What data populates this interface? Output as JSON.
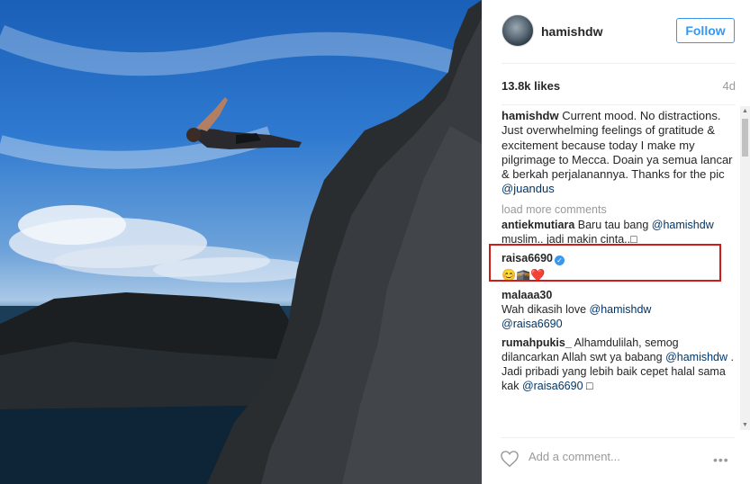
{
  "post": {
    "username": "hamishdw",
    "follow_label": "Follow",
    "likes": "13.8k likes",
    "time_ago": "4d",
    "caption_user": "hamishdw",
    "caption_text": " Current mood. No distractions. Just overwhelming feelings of gratitude & excitement because today I make my pilgrimage to Mecca. Doain ya semua lancar & berkah perjalanannya. Thanks for the pic ",
    "caption_mention": "@juandus",
    "load_more": "load more comments",
    "add_comment_placeholder": "Add a comment...",
    "more_glyph": "ooo"
  },
  "comments": [
    {
      "user": "antiekmutiara",
      "text_a": " Baru tau bang ",
      "mention": "@hamishdw",
      "text_b": " muslim.. jadi makin cinta..□"
    },
    {
      "user": "raisa6690",
      "emoji": "😊🕋❤️",
      "verified": "✓"
    },
    {
      "user": "malaaa30",
      "text_a": "Wah dikasih love ",
      "mention": "@hamishdw",
      "mention2": "@raisa6690"
    },
    {
      "user": "rumahpukis_",
      "text_a": " Alhamdulilah, semog dilancarkan Allah swt ya babang ",
      "mention": "@hamishdw",
      "text_b": " . Jadi pribadi yang lebih baik cepet halal sama kak ",
      "mention2": "@raisa6690",
      "text_c": " □"
    }
  ],
  "colors": {
    "follow": "#3897f0",
    "highlight": "#d11a1a",
    "mention": "#003569"
  }
}
